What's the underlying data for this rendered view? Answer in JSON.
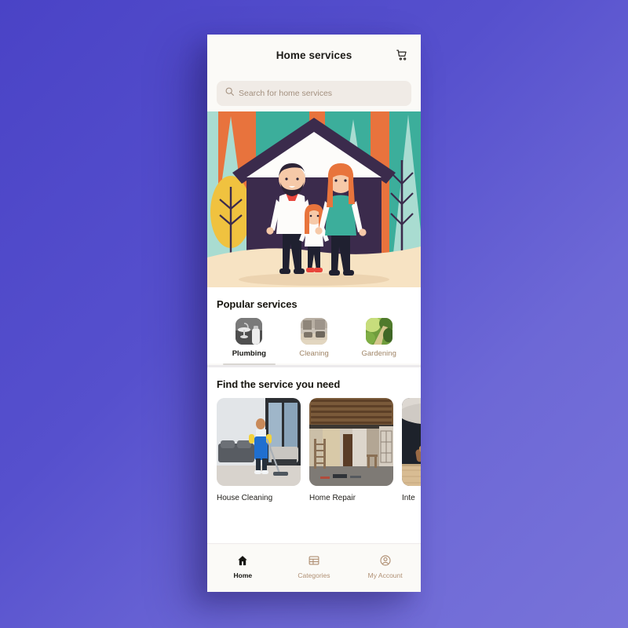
{
  "header": {
    "title": "Home services",
    "cart_icon": "shopping-cart-icon"
  },
  "search": {
    "placeholder": "Search for home services",
    "value": "",
    "icon": "search-icon"
  },
  "hero": {
    "alt": "flat illustration of a family of three standing in front of a house with trees",
    "colors": {
      "orange": "#e8733d",
      "teal": "#3cae9b",
      "mint": "#a9dcd1",
      "dark_purple": "#3b2b4c",
      "sand": "#f7e3c3",
      "yellow": "#f0c23f"
    }
  },
  "popular": {
    "title": "Popular services",
    "items": [
      {
        "label": "Plumbing",
        "active": true,
        "thumb": "bathroom-sink-photo"
      },
      {
        "label": "Cleaning",
        "active": false,
        "thumb": "living-room-photo"
      },
      {
        "label": "Gardening",
        "active": false,
        "thumb": "garden-path-photo"
      }
    ]
  },
  "find": {
    "title": "Find the service you need",
    "cards": [
      {
        "label": "House Cleaning",
        "image": "person-mopping-living-room-photo"
      },
      {
        "label": "Home Repair",
        "image": "room-under-renovation-photo"
      },
      {
        "label": "Inte",
        "image": "dark-interior-room-photo"
      }
    ]
  },
  "bottom_nav": {
    "items": [
      {
        "label": "Home",
        "icon": "home-icon",
        "active": true
      },
      {
        "label": "Categories",
        "icon": "grid-icon",
        "active": false
      },
      {
        "label": "My Account",
        "icon": "person-circle-icon",
        "active": false
      }
    ]
  },
  "theme": {
    "background_start": "#4a43c6",
    "background_end": "#7873d9",
    "app_background": "#fbfaf7",
    "muted_text": "#a08567",
    "active_text": "#161512"
  }
}
